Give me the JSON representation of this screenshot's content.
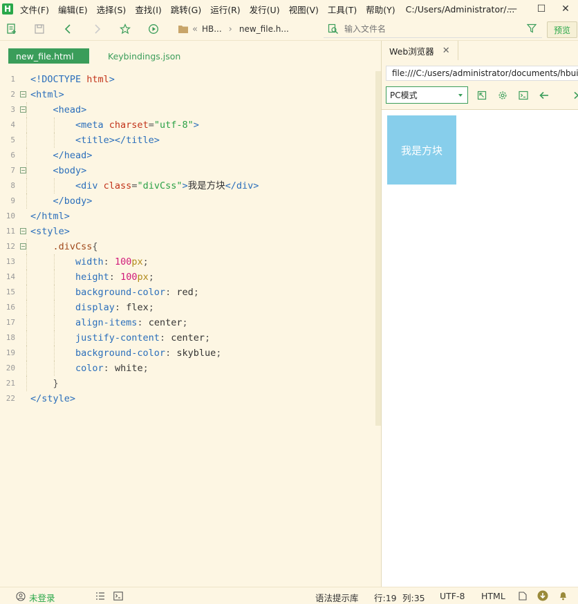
{
  "titlebar": {
    "logo": "H",
    "menus": [
      "文件(F)",
      "编辑(E)",
      "选择(S)",
      "查找(I)",
      "跳转(G)",
      "运行(R)",
      "发行(U)",
      "视图(V)",
      "工具(T)",
      "帮助(Y)"
    ],
    "window_title": "C:/Users/Administrator/...",
    "minimize": "—",
    "maximize": "☐",
    "close": "✕"
  },
  "toolbar": {
    "breadcrumb_prefix": "«",
    "breadcrumbs": [
      "HB...",
      "new_file.h..."
    ],
    "breadcrumb_separator": "›",
    "search_placeholder": "输入文件名",
    "preview_label": "预览"
  },
  "tabs": [
    {
      "label": "new_file.html",
      "active": true
    },
    {
      "label": "Keybindings.json",
      "active": false
    }
  ],
  "code_lines": [
    {
      "n": "1",
      "fold": false,
      "segs": [
        [
          "<!DOCTYPE ",
          "tag"
        ],
        [
          "html",
          "attr"
        ],
        [
          ">",
          "tag"
        ]
      ]
    },
    {
      "n": "2",
      "fold": true,
      "segs": [
        [
          "<html>",
          "tag"
        ]
      ]
    },
    {
      "n": "3",
      "fold": true,
      "indent": 1,
      "segs": [
        [
          "    <head>",
          "tag"
        ]
      ]
    },
    {
      "n": "4",
      "fold": false,
      "indent": 2,
      "segs": [
        [
          "        <meta ",
          "tag"
        ],
        [
          "charset",
          "attr"
        ],
        [
          "=",
          "punc"
        ],
        [
          "\"utf-8\"",
          "str"
        ],
        [
          ">",
          "tag"
        ]
      ]
    },
    {
      "n": "5",
      "fold": false,
      "indent": 2,
      "segs": [
        [
          "        <title></title>",
          "tag"
        ]
      ]
    },
    {
      "n": "6",
      "fold": false,
      "indent": 1,
      "segs": [
        [
          "    </head>",
          "tag"
        ]
      ]
    },
    {
      "n": "7",
      "fold": true,
      "indent": 1,
      "segs": [
        [
          "    <body>",
          "tag"
        ]
      ]
    },
    {
      "n": "8",
      "fold": false,
      "indent": 2,
      "segs": [
        [
          "        <div ",
          "tag"
        ],
        [
          "class",
          "attr"
        ],
        [
          "=",
          "punc"
        ],
        [
          "\"divCss\"",
          "str"
        ],
        [
          ">",
          "tag"
        ],
        [
          "我是方块",
          "plain"
        ],
        [
          "</div>",
          "tag"
        ]
      ]
    },
    {
      "n": "9",
      "fold": false,
      "indent": 1,
      "segs": [
        [
          "    </body>",
          "tag"
        ]
      ]
    },
    {
      "n": "10",
      "fold": false,
      "segs": [
        [
          "</html>",
          "tag"
        ]
      ]
    },
    {
      "n": "11",
      "fold": true,
      "segs": [
        [
          "<style>",
          "tag"
        ]
      ]
    },
    {
      "n": "12",
      "fold": true,
      "indent": 1,
      "segs": [
        [
          "    .divCss",
          "sel"
        ],
        [
          "{",
          "punc"
        ]
      ]
    },
    {
      "n": "13",
      "fold": false,
      "indent": 2,
      "segs": [
        [
          "        width",
          "prop"
        ],
        [
          ": ",
          "punc"
        ],
        [
          "100",
          "num"
        ],
        [
          "px",
          "unit"
        ],
        [
          ";",
          "punc"
        ]
      ]
    },
    {
      "n": "14",
      "fold": false,
      "indent": 2,
      "segs": [
        [
          "        height",
          "prop"
        ],
        [
          ": ",
          "punc"
        ],
        [
          "100",
          "num"
        ],
        [
          "px",
          "unit"
        ],
        [
          ";",
          "punc"
        ]
      ]
    },
    {
      "n": "15",
      "fold": false,
      "indent": 2,
      "segs": [
        [
          "        background-color",
          "prop"
        ],
        [
          ": ",
          "punc"
        ],
        [
          "red",
          "plain"
        ],
        [
          ";",
          "punc"
        ]
      ]
    },
    {
      "n": "16",
      "fold": false,
      "indent": 2,
      "segs": [
        [
          "        display",
          "prop"
        ],
        [
          ": ",
          "punc"
        ],
        [
          "flex",
          "plain"
        ],
        [
          ";",
          "punc"
        ]
      ]
    },
    {
      "n": "17",
      "fold": false,
      "indent": 2,
      "segs": [
        [
          "        align-items",
          "prop"
        ],
        [
          ": ",
          "punc"
        ],
        [
          "center",
          "plain"
        ],
        [
          ";",
          "punc"
        ]
      ]
    },
    {
      "n": "18",
      "fold": false,
      "indent": 2,
      "segs": [
        [
          "        justify-content",
          "prop"
        ],
        [
          ": ",
          "punc"
        ],
        [
          "center",
          "plain"
        ],
        [
          ";",
          "punc"
        ]
      ]
    },
    {
      "n": "19",
      "fold": false,
      "indent": 2,
      "segs": [
        [
          "        background-color",
          "prop"
        ],
        [
          ": ",
          "punc"
        ],
        [
          "skyblue",
          "plain"
        ],
        [
          ";",
          "punc"
        ]
      ]
    },
    {
      "n": "20",
      "fold": false,
      "indent": 2,
      "segs": [
        [
          "        color",
          "prop"
        ],
        [
          ": ",
          "punc"
        ],
        [
          "white",
          "plain"
        ],
        [
          ";",
          "punc"
        ]
      ]
    },
    {
      "n": "21",
      "fold": false,
      "indent": 1,
      "segs": [
        [
          "    }",
          "punc"
        ]
      ]
    },
    {
      "n": "22",
      "fold": false,
      "segs": [
        [
          "</style>",
          "tag"
        ]
      ]
    }
  ],
  "browser": {
    "tab_label": "Web浏览器",
    "tab_close": "✕",
    "url": "file:///C:/users/administrator/documents/hbuilderprojects",
    "mode": "PC模式",
    "preview_text": "我是方块",
    "preview_bg": "#87ceeb"
  },
  "statusbar": {
    "login": "未登录",
    "syntax_lib": "语法提示库",
    "line": "行:19",
    "col": "列:35",
    "encoding": "UTF-8",
    "language": "HTML"
  },
  "colors": {
    "accent_green": "#3a9d5a",
    "editor_bg": "#fdf6e3"
  }
}
